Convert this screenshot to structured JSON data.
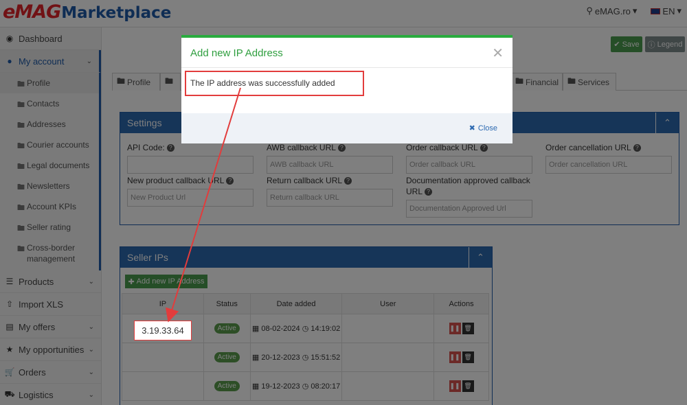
{
  "header": {
    "logo_emag": "eMAG",
    "logo_marketplace": "Marketplace",
    "site": "eMAG.ro",
    "lang": "EN"
  },
  "sidebar": {
    "dashboard": "Dashboard",
    "my_account": "My account",
    "sub": [
      "Profile",
      "Contacts",
      "Addresses",
      "Courier accounts",
      "Legal documents",
      "Newsletters",
      "Account KPIs",
      "Seller rating",
      "Cross-border management"
    ],
    "products": "Products",
    "import_xls": "Import XLS",
    "my_offers": "My offers",
    "my_opportunities": "My opportunities",
    "orders": "Orders",
    "logistics": "Logistics"
  },
  "toolbar": {
    "save": "Save",
    "legend": "Legend"
  },
  "tabs": {
    "profile": "Profile",
    "financial": "Financial",
    "services": "Services"
  },
  "settings": {
    "title": "Settings",
    "fields": {
      "api_code": "API Code:",
      "awb_callback": "AWB callback URL",
      "awb_callback_ph": "AWB callback URL",
      "order_callback": "Order callback URL",
      "order_callback_ph": "Order callback URL",
      "order_cancel": "Order cancellation URL",
      "order_cancel_ph": "Order cancellation URL",
      "new_product": "New product callback URL",
      "new_product_ph": "New Product Url",
      "return_callback": "Return callback URL",
      "return_callback_ph": "Return callback URL",
      "doc_approved": "Documentation approved callback URL",
      "doc_approved_ph": "Documentation Approved Url"
    }
  },
  "seller_ips": {
    "title": "Seller IPs",
    "add_button": "Add new IP Address",
    "columns": [
      "IP",
      "Status",
      "Date added",
      "User",
      "Actions"
    ],
    "rows": [
      {
        "ip": "3.19.33.64",
        "status": "Active",
        "date": "08-02-2024",
        "time": "14:19:02"
      },
      {
        "ip": "",
        "status": "Active",
        "date": "20-12-2023",
        "time": "15:51:52"
      },
      {
        "ip": "",
        "status": "Active",
        "date": "19-12-2023",
        "time": "08:20:17"
      }
    ]
  },
  "modal": {
    "title": "Add new IP Address",
    "message": "The IP address was successfully added",
    "close": "Close"
  },
  "colors": {
    "accent": "#1e5aa8",
    "success": "#2aab3f",
    "annotation": "#e23c3c"
  }
}
